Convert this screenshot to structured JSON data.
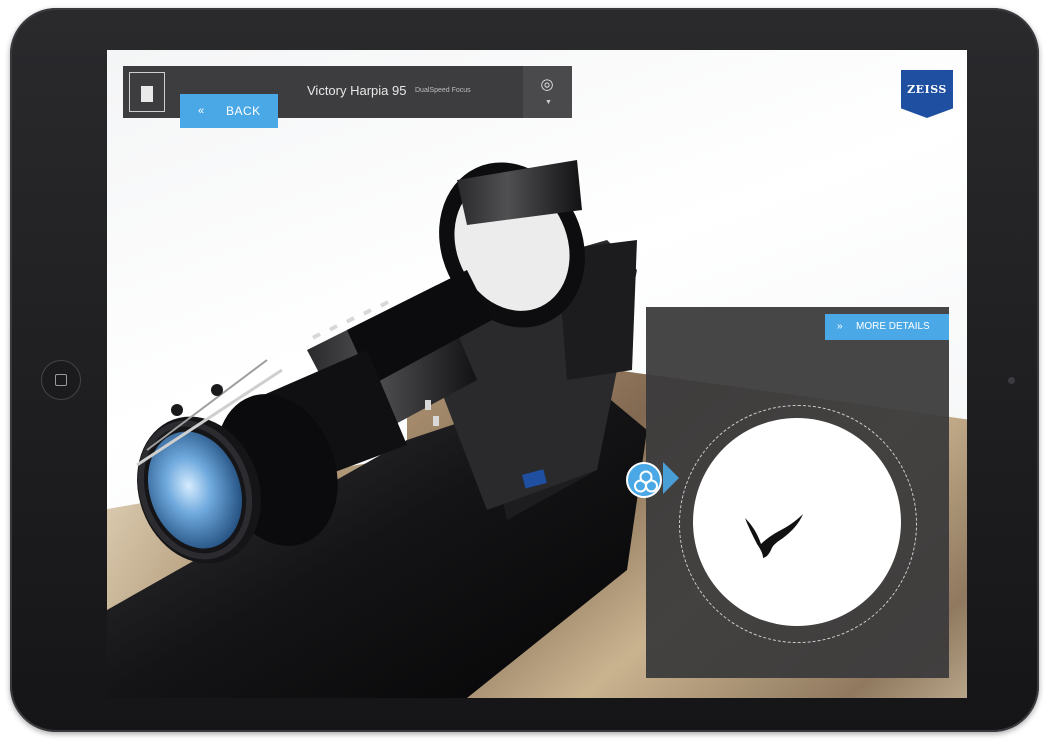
{
  "app": {
    "product_title": "Victory Harpia 95",
    "product_subtitle": "DualSpeed Focus"
  },
  "nav": {
    "back_label": "BACK",
    "back_icon": "chevron-double-left-icon",
    "globe_icon": "globe-icon"
  },
  "brand": {
    "logo_text": "ZEISS",
    "logo_color": "#1e4fa0"
  },
  "detail": {
    "more_details_label": "MORE DETAILS",
    "hotspot_icon": "lens-elements-icon",
    "preview_icon": "bird-silhouette-icon"
  },
  "colors": {
    "accent": "#4aa8e6",
    "bar": "#3d3d3f",
    "panel": "#3a3a3c"
  }
}
